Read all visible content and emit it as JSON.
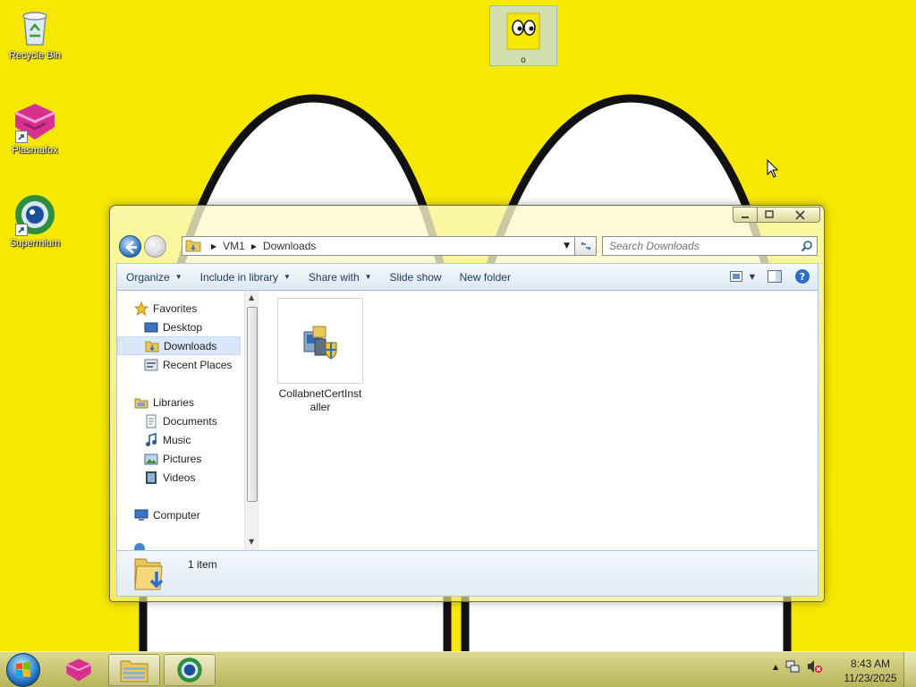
{
  "desktop": {
    "icons": [
      {
        "label": "Recycle Bin",
        "icon": "recycle-bin-icon"
      },
      {
        "label": "Plasmafox",
        "icon": "plasmafox-icon"
      },
      {
        "label": "Supermium",
        "icon": "supermium-icon"
      }
    ],
    "selected_icon": {
      "label": "o",
      "icon": "face-icon"
    }
  },
  "explorer": {
    "breadcrumb": [
      "VM1",
      "Downloads"
    ],
    "search_placeholder": "Search Downloads",
    "toolbar": {
      "organize": "Organize",
      "include_in_library": "Include in library",
      "share_with": "Share with",
      "slide_show": "Slide show",
      "new_folder": "New folder"
    },
    "nav": {
      "favorites": "Favorites",
      "desktop": "Desktop",
      "downloads": "Downloads",
      "recent_places": "Recent Places",
      "libraries": "Libraries",
      "documents": "Documents",
      "music": "Music",
      "pictures": "Pictures",
      "videos": "Videos",
      "computer": "Computer"
    },
    "files": [
      {
        "name": "CollabnetCertInstaller",
        "icon": "installer-icon"
      }
    ],
    "status": {
      "item_count": "1 item"
    }
  },
  "taskbar": {
    "clock_time": "8:43 AM",
    "clock_date": "11/23/2025",
    "apps": [
      "plasmafox-icon",
      "explorer-icon",
      "supermium-icon"
    ]
  },
  "colors": {
    "wallpaper": "#f7e800",
    "accent": "#2f6fb8",
    "selection": "#d9e8f9"
  }
}
